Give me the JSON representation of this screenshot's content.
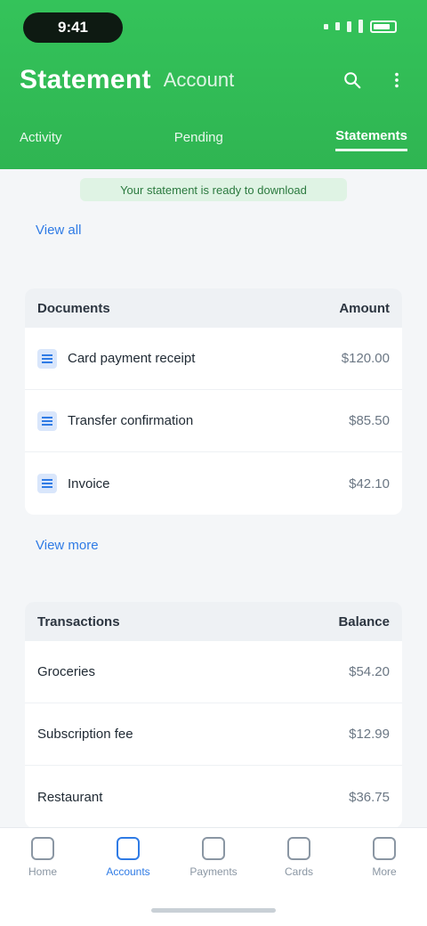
{
  "status": {
    "time": "9:41"
  },
  "header": {
    "title": "Statement",
    "subtitle": "Account",
    "tabs": [
      {
        "label": "Activity"
      },
      {
        "label": "Pending"
      },
      {
        "label": "Statements"
      }
    ]
  },
  "notice": {
    "text": "Your statement is ready to download"
  },
  "documents": {
    "link_label": "View all",
    "head_left": "Documents",
    "head_right": "Amount",
    "rows": [
      {
        "name": "Card payment receipt",
        "amount": "$120.00"
      },
      {
        "name": "Transfer confirmation",
        "amount": "$85.50"
      },
      {
        "name": "Invoice",
        "amount": "$42.10"
      }
    ]
  },
  "summary": {
    "link_label": "View more",
    "head_left": "Transactions",
    "head_right": "Balance",
    "rows": [
      {
        "name": "Groceries",
        "amount": "$54.20"
      },
      {
        "name": "Subscription fee",
        "amount": "$12.99"
      },
      {
        "name": "Restaurant",
        "amount": "$36.75"
      }
    ]
  },
  "tabbar": {
    "items": [
      {
        "label": "Home"
      },
      {
        "label": "Accounts"
      },
      {
        "label": "Payments"
      },
      {
        "label": "Cards"
      },
      {
        "label": "More"
      }
    ]
  },
  "colors": {
    "header_green": "#2fb552",
    "accent_blue": "#2f7be5"
  }
}
